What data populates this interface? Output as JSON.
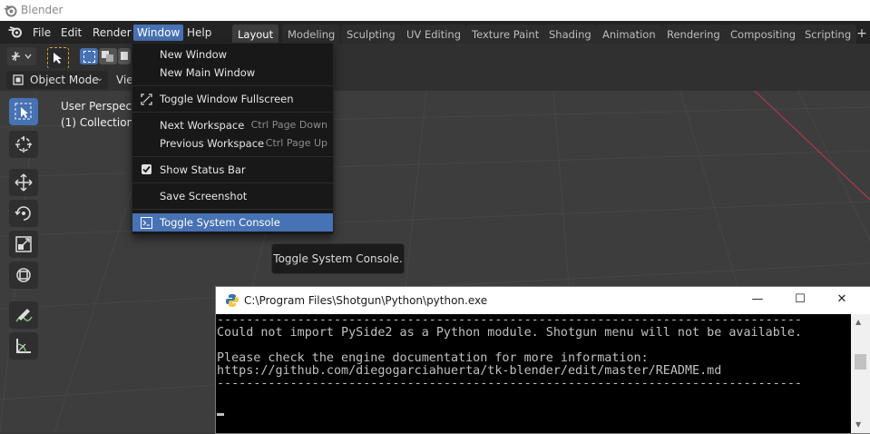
{
  "window": {
    "title": "Blender"
  },
  "menubar": {
    "items": [
      "File",
      "Edit",
      "Render",
      "Window",
      "Help"
    ],
    "active_item": "Window",
    "workspace_tabs": [
      "Layout",
      "Modeling",
      "Sculpting",
      "UV Editing",
      "Texture Paint",
      "Shading",
      "Animation",
      "Rendering",
      "Compositing",
      "Scripting"
    ],
    "active_tab": "Layout",
    "add_tab_symbol": "+"
  },
  "viewport": {
    "mode_label": "Object Mode",
    "view_menu": "Vie",
    "overlay_line1": "User Perspective",
    "overlay_line2": "(1) Collection | ",
    "colors": {
      "accent": "#4772b3",
      "background": "#3d3d3d",
      "grid_line": "#444444",
      "x_axis": "#a8384c"
    }
  },
  "toolbar": {
    "tools": [
      "select-box-tool",
      "cursor-tool",
      "move-tool",
      "rotate-tool",
      "scale-tool",
      "transform-tool",
      "annotate-tool",
      "measure-tool"
    ],
    "active_tool": "select-box-tool"
  },
  "window_menu": {
    "items": [
      {
        "label": "New Window",
        "shortcut": "",
        "icon": ""
      },
      {
        "label": "New Main Window",
        "shortcut": "",
        "icon": ""
      },
      {
        "label": "Toggle Window Fullscreen",
        "shortcut": "",
        "icon": "fullscreen-icon"
      },
      {
        "label": "Next Workspace",
        "shortcut": "Ctrl Page Down",
        "icon": ""
      },
      {
        "label": "Previous Workspace",
        "shortcut": "Ctrl Page Up",
        "icon": ""
      },
      {
        "label": "Show Status Bar",
        "shortcut": "",
        "icon": "checkbox-icon",
        "checked": true
      },
      {
        "label": "Save Screenshot",
        "shortcut": "",
        "icon": ""
      },
      {
        "label": "Toggle System Console",
        "shortcut": "",
        "icon": "console-icon",
        "highlighted": true
      }
    ]
  },
  "tooltip": {
    "text": "Toggle System Console."
  },
  "console": {
    "title": "C:\\Program Files\\Shotgun\\Python\\python.exe",
    "lines": [
      "--------------------------------------------------------------------------------",
      "Could not import PySide2 as a Python module. Shotgun menu will not be available.",
      "",
      "Please check the engine documentation for more information:",
      "https://github.com/diegogarciahuerta/tk-blender/edit/master/README.md",
      "--------------------------------------------------------------------------------"
    ],
    "minimize_symbol": "—",
    "maximize_symbol": "☐",
    "close_symbol": "✕"
  }
}
